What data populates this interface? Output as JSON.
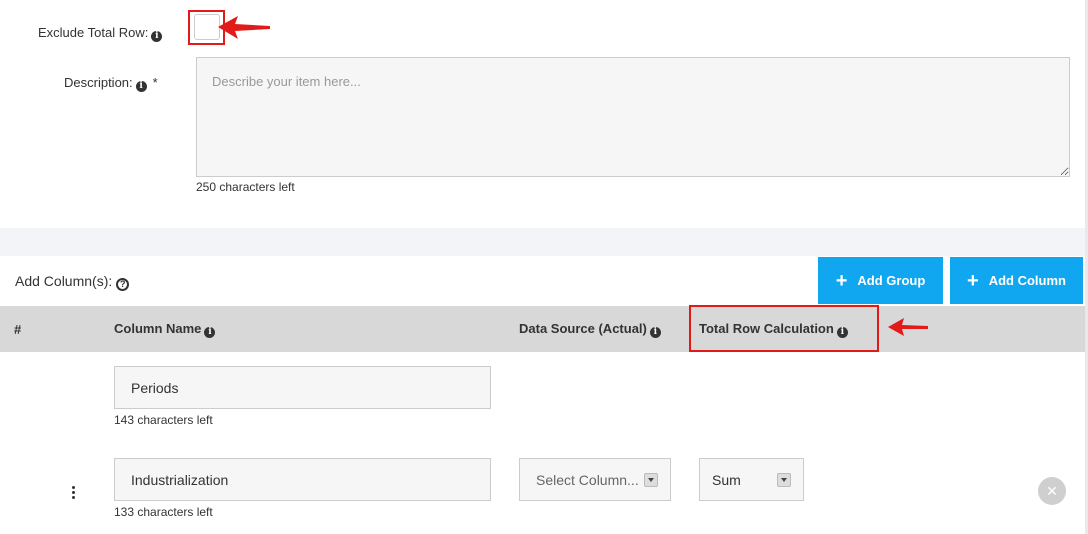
{
  "form": {
    "exclude_total_row_label": "Exclude Total Row:",
    "description_label": "Description:",
    "required_mark": "*",
    "description_placeholder": "Describe your item here...",
    "description_chars_left": "250 characters left"
  },
  "columns_section": {
    "title": "Add Column(s):",
    "add_group_label": "Add Group",
    "add_column_label": "Add Column",
    "headers": {
      "number": "#",
      "column_name": "Column Name",
      "data_source": "Data Source (Actual)",
      "total_row_calculation": "Total Row Calculation"
    },
    "rows": [
      {
        "name": "Periods",
        "chars_left": "143 characters left"
      },
      {
        "name": "Industrialization",
        "chars_left": "133 characters left",
        "data_source": "Select Column...",
        "calculation": "Sum"
      }
    ]
  },
  "colors": {
    "accent_blue": "#11a7f0",
    "annotation_red": "#e31a1a",
    "header_gray": "#d8d8d8"
  }
}
